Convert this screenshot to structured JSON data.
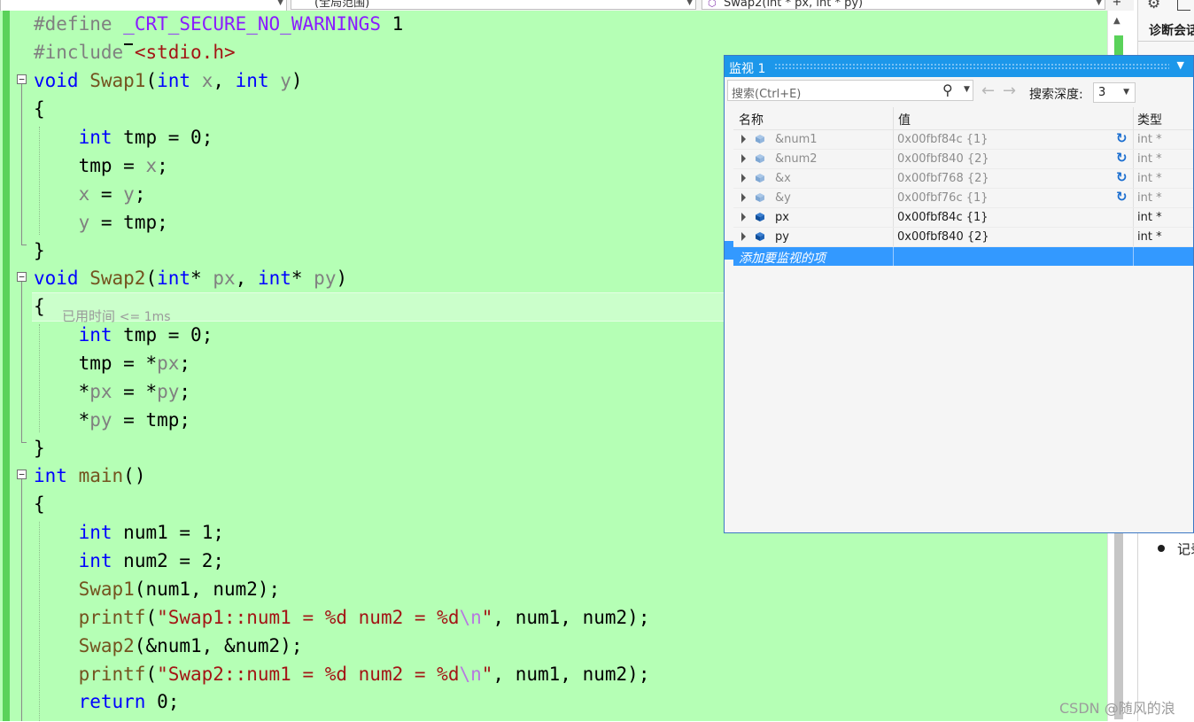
{
  "nav": {
    "scope_label": "(全局范围)",
    "function_label": "Swap2(int * px, int * py)"
  },
  "code": {
    "line1": {
      "directive": "#define",
      "macro": "_CRT_SECURE_NO_WARNINGS",
      "value": "1"
    },
    "line2": {
      "directive": "#include",
      "header": "<stdio.h>"
    },
    "swap1_sig": {
      "ret": "void",
      "name": "Swap1",
      "t1": "int",
      "p1": "x",
      "t2": "int",
      "p2": "y"
    },
    "swap1_body": {
      "l1_type": "int",
      "l1_var": "tmp",
      "l1_val": "0",
      "l2_var": "tmp",
      "l2_src": "x",
      "l3_var": "x",
      "l3_src": "y",
      "l4_var": "y",
      "l4_src": "tmp"
    },
    "swap2_sig": {
      "ret": "void",
      "name": "Swap2",
      "t1": "int",
      "p1": "px",
      "t2": "int",
      "p2": "py"
    },
    "elapsed": {
      "label": "已用时间",
      "value": "<= 1ms"
    },
    "swap2_body": {
      "l1_type": "int",
      "l1_var": "tmp",
      "l1_val": "0",
      "l2_var": "tmp",
      "l2_src": "px",
      "l3_var": "px",
      "l3_src": "py",
      "l4_var": "py",
      "l4_src": "tmp"
    },
    "main_sig": {
      "ret": "int",
      "name": "main"
    },
    "main_body": {
      "d1_type": "int",
      "d1_var": "num1",
      "d1_val": "1",
      "d2_type": "int",
      "d2_var": "num2",
      "d2_val": "2",
      "c1_fn": "Swap1",
      "c1_a1": "num1",
      "c1_a2": "num2",
      "p1_fn": "printf",
      "p1_str": "\"Swap1::num1 = %d num2 = %d",
      "p1_esc": "\\n",
      "p1_end": "\"",
      "p1_a1": "num1",
      "p1_a2": "num2",
      "c2_fn": "Swap2",
      "c2_a1": "num1",
      "c2_a2": "num2",
      "p2_fn": "printf",
      "p2_str": "\"Swap2::num1 = %d num2 = %d",
      "p2_esc": "\\n",
      "p2_end": "\"",
      "p2_a1": "num1",
      "p2_a2": "num2",
      "ret_kw": "return",
      "ret_val": "0"
    }
  },
  "watch": {
    "title": "监视 1",
    "search_placeholder": "搜索(Ctrl+E)",
    "depth_label": "搜索深度:",
    "depth_value": "3",
    "columns": {
      "name": "名称",
      "value": "值",
      "type": "类型"
    },
    "rows": [
      {
        "name": "&num1",
        "value": "0x00fbf84c {1}",
        "type": "int *"
      },
      {
        "name": "&num2",
        "value": "0x00fbf840 {2}",
        "type": "int *"
      },
      {
        "name": "&x",
        "value": "0x00fbf768 {2}",
        "type": "int *"
      },
      {
        "name": "&y",
        "value": "0x00fbf76c {1}",
        "type": "int *"
      },
      {
        "name": "px",
        "value": "0x00fbf84c {1}",
        "type": "int *"
      },
      {
        "name": "py",
        "value": "0x00fbf840 {2}",
        "type": "int *"
      }
    ],
    "add_item": "添加要监视的项"
  },
  "diag": {
    "title": "诊断会话",
    "item": "记录"
  },
  "watermark": "CSDN @随风的浪",
  "colors": {
    "editor_bg": "#b5ffb5",
    "change_bar": "#5ad25a",
    "keyword": "#0000ff",
    "function": "#74531f",
    "string": "#a31515",
    "macro": "#8a1bff",
    "watch_title": "#1c97ea",
    "selection": "#3399ff"
  }
}
